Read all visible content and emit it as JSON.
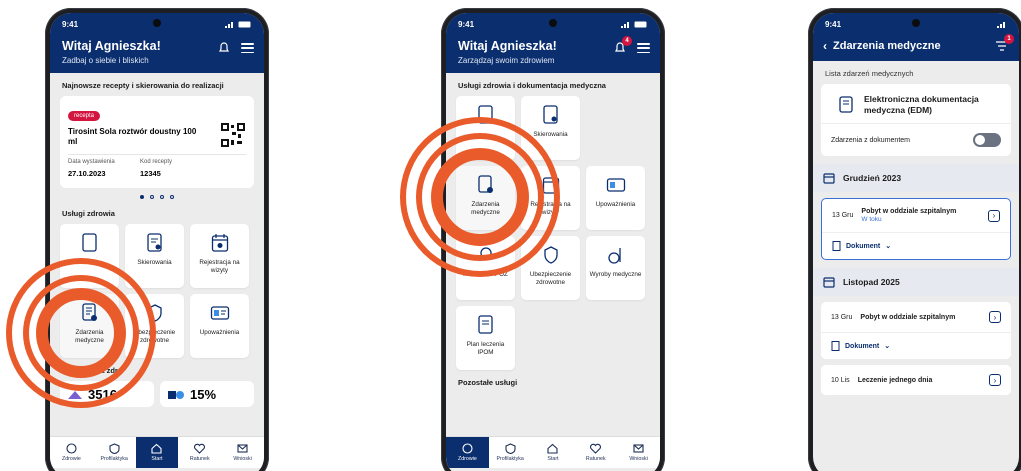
{
  "phone1": {
    "status": {
      "time": "9:41"
    },
    "header": {
      "title": "Witaj Agnieszka!",
      "subtitle": "Zadbaj o siebie i bliskich"
    },
    "rx_section_title": "Najnowsze recepty i skierowania do realizacji",
    "rx_card": {
      "badge": "recepta",
      "name": "Tirosint Sola roztwór doustny 100 ml",
      "issued_label": "Data wystawienia",
      "issued_value": "27.10.2023",
      "code_label": "Kod recepty",
      "code_value": "12345"
    },
    "services_title": "Usługi zdrowia",
    "tiles": [
      {
        "label": "",
        "icon": "document-icon"
      },
      {
        "label": "Skierowania",
        "icon": "referral-icon"
      },
      {
        "label": "Rejestracja na wizyty",
        "icon": "calendar-icon"
      },
      {
        "label": "Zdarzenia medyczne",
        "icon": "medical-events-icon"
      },
      {
        "label": "Ubezpieczenie zdrowotne",
        "icon": "insurance-icon"
      },
      {
        "label": "Upoważnienia",
        "icon": "authorization-icon"
      }
    ],
    "prevention_title": "Profilaktyka zdr",
    "stat1": "3516",
    "stat2": "15%",
    "nav": [
      {
        "label": "Zdrowie",
        "icon": "health-icon"
      },
      {
        "label": "Profilaktyka",
        "icon": "shield-icon"
      },
      {
        "label": "Start",
        "icon": "home-icon"
      },
      {
        "label": "Ratunek",
        "icon": "heart-icon"
      },
      {
        "label": "Wnioski",
        "icon": "mail-icon"
      }
    ],
    "nav_active": 2
  },
  "phone2": {
    "status": {
      "time": "9:41"
    },
    "header": {
      "title": "Witaj Agnieszka!",
      "subtitle": "Zarządzaj swoim zdrowiem",
      "badge": "4"
    },
    "section_title": "Usługi zdrowia i dokumentacja medyczna",
    "tiles": [
      {
        "label": "",
        "icon": "document-icon"
      },
      {
        "label": "Skierowania",
        "icon": "referral-icon"
      },
      {
        "label": "",
        "icon": "blank"
      },
      {
        "label": "Zdarzenia medyczne",
        "icon": "medical-events-icon"
      },
      {
        "label": "Rejestracja na wizyty",
        "icon": "calendar-icon"
      },
      {
        "label": "Upoważnienia",
        "icon": "authorization-icon"
      },
      {
        "label": "Kontakt do POZ",
        "icon": "contact-icon"
      },
      {
        "label": "Ubezpieczenie zdrowotne",
        "icon": "insurance-icon"
      },
      {
        "label": "Wyroby medyczne",
        "icon": "wheelchair-icon"
      },
      {
        "label": "Plan leczenia IPOM",
        "icon": "plan-icon"
      }
    ],
    "other_title": "Pozostałe usługi",
    "nav": [
      {
        "label": "Zdrowie",
        "icon": "health-icon"
      },
      {
        "label": "Profilaktyka",
        "icon": "shield-icon"
      },
      {
        "label": "Start",
        "icon": "home-icon"
      },
      {
        "label": "Ratunek",
        "icon": "heart-icon"
      },
      {
        "label": "Wnioski",
        "icon": "mail-icon"
      }
    ],
    "nav_active": 0
  },
  "phone3": {
    "status": {
      "time": "9:41"
    },
    "header": {
      "title": "Zdarzenia medyczne",
      "badge": "1"
    },
    "list_title": "Lista zdarzeń medycznych",
    "edm_label": "Elektroniczna dokumentacja medyczna (EDM)",
    "toggle_label": "Zdarzenia z dokumentem",
    "months": [
      {
        "title": "Grudzień 2023",
        "events": [
          {
            "date": "13 Gru",
            "name": "Pobyt w oddziale szpitalnym",
            "status": "W toku",
            "doc": "Dokument"
          }
        ]
      },
      {
        "title": "Listopad 2025",
        "events": [
          {
            "date": "13 Gru",
            "name": "Pobyt w oddziale szpitalnym",
            "status": "",
            "doc": "Dokument"
          },
          {
            "date": "10 Lis",
            "name": "Leczenie jednego dnia",
            "status": "",
            "doc": ""
          }
        ]
      }
    ]
  },
  "colors": {
    "navy": "#0a2e6e",
    "accent": "#ea5b2b",
    "badge": "#d3163f"
  }
}
